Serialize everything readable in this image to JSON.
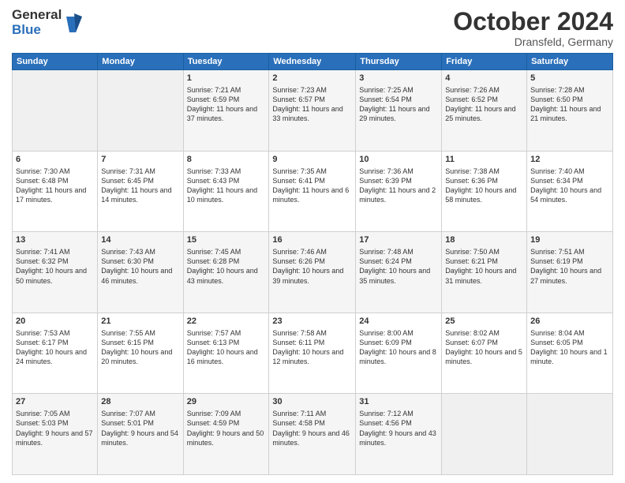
{
  "logo": {
    "general": "General",
    "blue": "Blue"
  },
  "title": "October 2024",
  "location": "Dransfeld, Germany",
  "days_of_week": [
    "Sunday",
    "Monday",
    "Tuesday",
    "Wednesday",
    "Thursday",
    "Friday",
    "Saturday"
  ],
  "weeks": [
    [
      {
        "day": "",
        "info": ""
      },
      {
        "day": "",
        "info": ""
      },
      {
        "day": "1",
        "info": "Sunrise: 7:21 AM\nSunset: 6:59 PM\nDaylight: 11 hours and 37 minutes."
      },
      {
        "day": "2",
        "info": "Sunrise: 7:23 AM\nSunset: 6:57 PM\nDaylight: 11 hours and 33 minutes."
      },
      {
        "day": "3",
        "info": "Sunrise: 7:25 AM\nSunset: 6:54 PM\nDaylight: 11 hours and 29 minutes."
      },
      {
        "day": "4",
        "info": "Sunrise: 7:26 AM\nSunset: 6:52 PM\nDaylight: 11 hours and 25 minutes."
      },
      {
        "day": "5",
        "info": "Sunrise: 7:28 AM\nSunset: 6:50 PM\nDaylight: 11 hours and 21 minutes."
      }
    ],
    [
      {
        "day": "6",
        "info": "Sunrise: 7:30 AM\nSunset: 6:48 PM\nDaylight: 11 hours and 17 minutes."
      },
      {
        "day": "7",
        "info": "Sunrise: 7:31 AM\nSunset: 6:45 PM\nDaylight: 11 hours and 14 minutes."
      },
      {
        "day": "8",
        "info": "Sunrise: 7:33 AM\nSunset: 6:43 PM\nDaylight: 11 hours and 10 minutes."
      },
      {
        "day": "9",
        "info": "Sunrise: 7:35 AM\nSunset: 6:41 PM\nDaylight: 11 hours and 6 minutes."
      },
      {
        "day": "10",
        "info": "Sunrise: 7:36 AM\nSunset: 6:39 PM\nDaylight: 11 hours and 2 minutes."
      },
      {
        "day": "11",
        "info": "Sunrise: 7:38 AM\nSunset: 6:36 PM\nDaylight: 10 hours and 58 minutes."
      },
      {
        "day": "12",
        "info": "Sunrise: 7:40 AM\nSunset: 6:34 PM\nDaylight: 10 hours and 54 minutes."
      }
    ],
    [
      {
        "day": "13",
        "info": "Sunrise: 7:41 AM\nSunset: 6:32 PM\nDaylight: 10 hours and 50 minutes."
      },
      {
        "day": "14",
        "info": "Sunrise: 7:43 AM\nSunset: 6:30 PM\nDaylight: 10 hours and 46 minutes."
      },
      {
        "day": "15",
        "info": "Sunrise: 7:45 AM\nSunset: 6:28 PM\nDaylight: 10 hours and 43 minutes."
      },
      {
        "day": "16",
        "info": "Sunrise: 7:46 AM\nSunset: 6:26 PM\nDaylight: 10 hours and 39 minutes."
      },
      {
        "day": "17",
        "info": "Sunrise: 7:48 AM\nSunset: 6:24 PM\nDaylight: 10 hours and 35 minutes."
      },
      {
        "day": "18",
        "info": "Sunrise: 7:50 AM\nSunset: 6:21 PM\nDaylight: 10 hours and 31 minutes."
      },
      {
        "day": "19",
        "info": "Sunrise: 7:51 AM\nSunset: 6:19 PM\nDaylight: 10 hours and 27 minutes."
      }
    ],
    [
      {
        "day": "20",
        "info": "Sunrise: 7:53 AM\nSunset: 6:17 PM\nDaylight: 10 hours and 24 minutes."
      },
      {
        "day": "21",
        "info": "Sunrise: 7:55 AM\nSunset: 6:15 PM\nDaylight: 10 hours and 20 minutes."
      },
      {
        "day": "22",
        "info": "Sunrise: 7:57 AM\nSunset: 6:13 PM\nDaylight: 10 hours and 16 minutes."
      },
      {
        "day": "23",
        "info": "Sunrise: 7:58 AM\nSunset: 6:11 PM\nDaylight: 10 hours and 12 minutes."
      },
      {
        "day": "24",
        "info": "Sunrise: 8:00 AM\nSunset: 6:09 PM\nDaylight: 10 hours and 8 minutes."
      },
      {
        "day": "25",
        "info": "Sunrise: 8:02 AM\nSunset: 6:07 PM\nDaylight: 10 hours and 5 minutes."
      },
      {
        "day": "26",
        "info": "Sunrise: 8:04 AM\nSunset: 6:05 PM\nDaylight: 10 hours and 1 minute."
      }
    ],
    [
      {
        "day": "27",
        "info": "Sunrise: 7:05 AM\nSunset: 5:03 PM\nDaylight: 9 hours and 57 minutes."
      },
      {
        "day": "28",
        "info": "Sunrise: 7:07 AM\nSunset: 5:01 PM\nDaylight: 9 hours and 54 minutes."
      },
      {
        "day": "29",
        "info": "Sunrise: 7:09 AM\nSunset: 4:59 PM\nDaylight: 9 hours and 50 minutes."
      },
      {
        "day": "30",
        "info": "Sunrise: 7:11 AM\nSunset: 4:58 PM\nDaylight: 9 hours and 46 minutes."
      },
      {
        "day": "31",
        "info": "Sunrise: 7:12 AM\nSunset: 4:56 PM\nDaylight: 9 hours and 43 minutes."
      },
      {
        "day": "",
        "info": ""
      },
      {
        "day": "",
        "info": ""
      }
    ]
  ]
}
